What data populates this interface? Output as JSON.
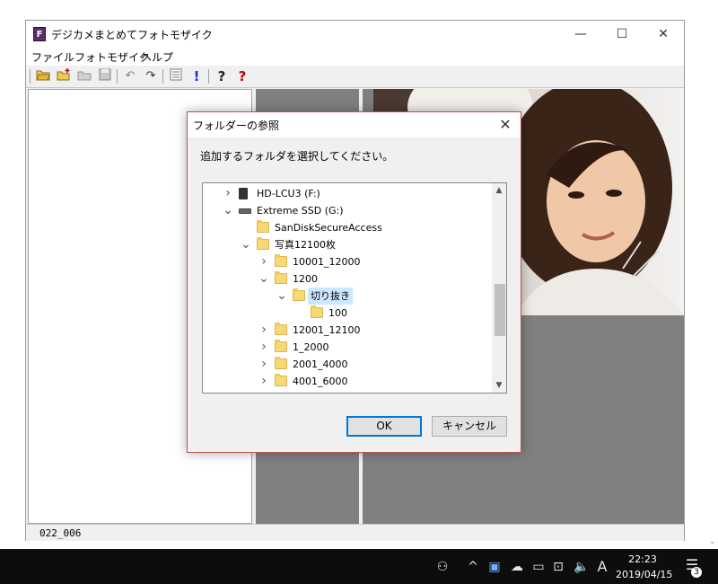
{
  "app": {
    "icon_letter": "F",
    "title": "デジカメまとめてフォトモザイク",
    "menu": [
      "ファイル",
      "フォトモザイク",
      "ヘルプ"
    ],
    "toolbar_icons": [
      "open-folder-icon",
      "new-folder-icon",
      "folder-disabled-icon",
      "save-icon",
      "undo-icon",
      "redo-icon",
      "list-icon",
      "exclamation-icon",
      "help-icon",
      "context-help-icon"
    ],
    "status": "022_006"
  },
  "dialog": {
    "title": "フォルダーの参照",
    "instruction": "追加するフォルダを選択してください。",
    "tree": [
      {
        "label": "HD-LCU3 (F:)",
        "expander": ">",
        "icon": "drive-icon"
      },
      {
        "label": "Extreme SSD (G:)",
        "expander": "v",
        "icon": "ssd-icon"
      },
      {
        "label": "SanDiskSecureAccess",
        "expander": "",
        "icon": "folder-icon"
      },
      {
        "label": "写真12100枚",
        "expander": "v",
        "icon": "folder-icon"
      },
      {
        "label": "10001_12000",
        "expander": ">",
        "icon": "folder-icon"
      },
      {
        "label": "1200",
        "expander": "v",
        "icon": "folder-icon"
      },
      {
        "label": "切り抜き",
        "expander": "v",
        "icon": "folder-icon",
        "selected": true
      },
      {
        "label": "100",
        "expander": "",
        "icon": "folder-icon"
      },
      {
        "label": "12001_12100",
        "expander": ">",
        "icon": "folder-icon"
      },
      {
        "label": "1_2000",
        "expander": ">",
        "icon": "folder-icon"
      },
      {
        "label": "2001_4000",
        "expander": ">",
        "icon": "folder-icon"
      },
      {
        "label": "4001_6000",
        "expander": ">",
        "icon": "folder-icon"
      }
    ],
    "ok_label": "OK",
    "cancel_label": "キャンセル"
  },
  "taskbar": {
    "ime": "A",
    "time": "22:23",
    "date": "2019/04/15",
    "notifications": "3"
  }
}
